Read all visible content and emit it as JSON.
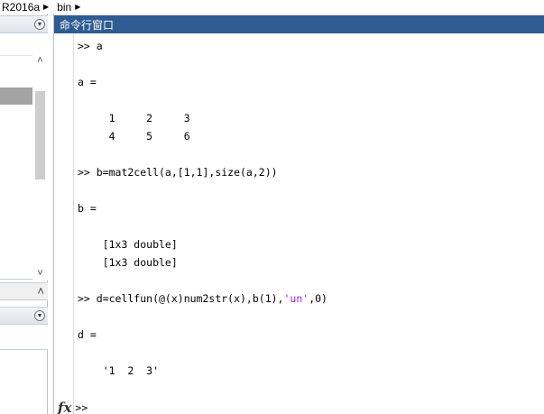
{
  "breadcrumb": {
    "items": [
      "R2016a",
      "bin"
    ]
  },
  "left_panel": {
    "header1_menu_icon": "dropdown-circle-icon",
    "header2_menu_icon": "dropdown-circle-icon",
    "collapse_icon": "chevron-up-icon"
  },
  "command_window": {
    "title": "命令行窗口",
    "prompt": ">>",
    "lines": [
      ">> a",
      "",
      "a =",
      "",
      "     1     2     3",
      "     4     5     6",
      "",
      ">> b=mat2cell(a,[1,1],size(a,2))",
      "",
      "b =",
      "",
      "    [1x3 double]",
      "    [1x3 double]",
      "",
      ">> d=cellfun(@(x)num2str(x),b(1),",
      "",
      "d =",
      "",
      "    '1  2  3'"
    ],
    "line14_string": "'un'",
    "line14_tail": ",0)",
    "fx_label": "fx"
  },
  "colors": {
    "titlebar_bg": "#2e5b92",
    "titlebar_text": "#ffffff",
    "string_literal": "#a020f0",
    "selected_row": "#a3a3a3"
  }
}
